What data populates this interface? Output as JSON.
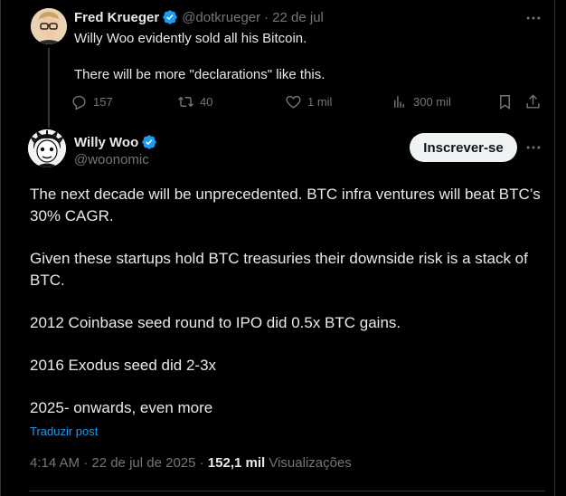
{
  "parent_tweet": {
    "author_name": "Fred Krueger",
    "handle": "@dotkrueger",
    "separator": "·",
    "date": "22 de jul",
    "line1": "Willy Woo evidently sold all his Bitcoin.",
    "line2": "There will be more \"declarations\" like this.",
    "actions": {
      "replies": "157",
      "reposts": "40",
      "likes": "1 mil",
      "views": "300 mil"
    }
  },
  "main_tweet": {
    "author_name": "Willy Woo",
    "handle": "@woonomic",
    "follow_label": "Inscrever-se",
    "body": [
      "The next decade will be unprecedented. BTC infra ventures will beat BTC’s 30% CAGR.",
      "Given these startups hold BTC treasuries their downside risk is a stack of BTC.",
      "2012 Coinbase seed round to IPO did 0.5x BTC gains.",
      "2016 Exodus seed did 2-3x",
      "2025- onwards, even more"
    ],
    "translate_label": "Traduzir post",
    "timestamp": "4:14 AM · 22 de jul de 2025 · ",
    "views_count": "152,1 mil",
    "views_label": " Visualizações"
  },
  "icons": {
    "verified": "verified-badge-icon",
    "more": "more-options-icon",
    "reply": "reply-icon",
    "repost": "repost-icon",
    "like": "heart-icon",
    "views": "views-icon",
    "bookmark": "bookmark-icon",
    "share": "share-icon"
  },
  "colors": {
    "background": "#000000",
    "text": "#e7e9ea",
    "muted": "#71767b",
    "accent": "#1d9bf0",
    "follow_bg": "#eff3f4"
  }
}
